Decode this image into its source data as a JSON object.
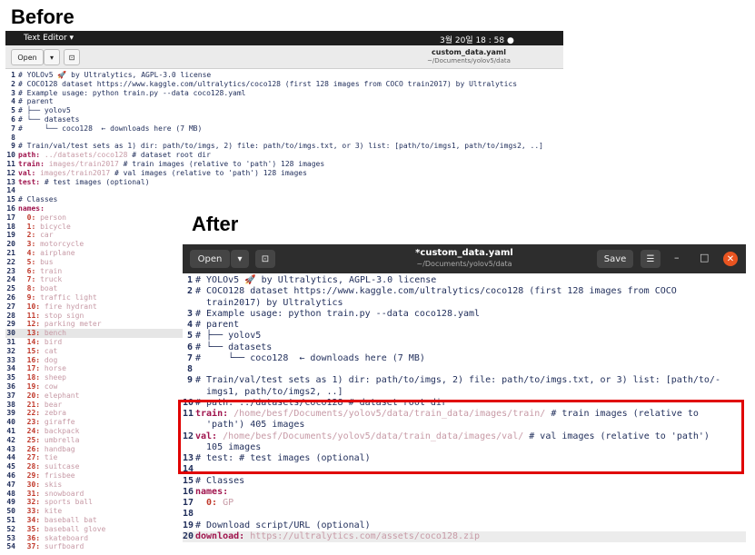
{
  "labels": {
    "before": "Before",
    "after": "After"
  },
  "colors": {
    "accent_red": "#e00000",
    "close_orange": "#e95420",
    "key": "#a0154e",
    "value": "#c79aa6"
  },
  "top_bar": {
    "app": "Text Editor ▾",
    "clock": "3월 20일  18 : 58  ●"
  },
  "before": {
    "open_label": "Open",
    "title": "custom_data.yaml",
    "subtitle": "~/Documents/yolov5/data",
    "lines": [
      {
        "n": "1",
        "t": "# YOLOv5 🚀 by Ultralytics, AGPL-3.0 license"
      },
      {
        "n": "2",
        "t": "# COCO128 dataset https://www.kaggle.com/ultralytics/coco128 (first 128 images from COCO train2017) by Ultralytics"
      },
      {
        "n": "3",
        "t": "# Example usage: python train.py --data coco128.yaml"
      },
      {
        "n": "4",
        "t": "# parent"
      },
      {
        "n": "5",
        "t": "# ├── yolov5"
      },
      {
        "n": "6",
        "t": "# └── datasets"
      },
      {
        "n": "7",
        "t": "#     └── coco128  ← downloads here (7 MB)"
      },
      {
        "n": "8",
        "t": ""
      },
      {
        "n": "9",
        "t": "# Train/val/test sets as 1) dir: path/to/imgs, 2) file: path/to/imgs.txt, or 3) list: [path/to/imgs1, path/to/imgs2, ..]"
      },
      {
        "n": "10",
        "k": "path:",
        "v": " ../datasets/coco128",
        "c": " # dataset root dir"
      },
      {
        "n": "11",
        "k": "train:",
        "v": " images/train2017",
        "c": " # train images (relative to 'path') 128 images"
      },
      {
        "n": "12",
        "k": "val:",
        "v": " images/train2017",
        "c": " # val images (relative to 'path') 128 images"
      },
      {
        "n": "13",
        "k": "test:",
        "v": "",
        "c": " # test images (optional)"
      },
      {
        "n": "14",
        "t": ""
      },
      {
        "n": "15",
        "t": "# Classes"
      },
      {
        "n": "16",
        "k": "names:",
        "v": "",
        "c": ""
      }
    ],
    "classes": [
      [
        "17",
        "0",
        "person"
      ],
      [
        "18",
        "1",
        "bicycle"
      ],
      [
        "19",
        "2",
        "car"
      ],
      [
        "20",
        "3",
        "motorcycle"
      ],
      [
        "21",
        "4",
        "airplane"
      ],
      [
        "22",
        "5",
        "bus"
      ],
      [
        "23",
        "6",
        "train"
      ],
      [
        "24",
        "7",
        "truck"
      ],
      [
        "25",
        "8",
        "boat"
      ],
      [
        "26",
        "9",
        "traffic light"
      ],
      [
        "27",
        "10",
        "fire hydrant"
      ],
      [
        "28",
        "11",
        "stop sign"
      ],
      [
        "29",
        "12",
        "parking meter"
      ],
      [
        "30",
        "13",
        "bench"
      ],
      [
        "31",
        "14",
        "bird"
      ],
      [
        "32",
        "15",
        "cat"
      ],
      [
        "33",
        "16",
        "dog"
      ],
      [
        "34",
        "17",
        "horse"
      ],
      [
        "35",
        "18",
        "sheep"
      ],
      [
        "36",
        "19",
        "cow"
      ],
      [
        "37",
        "20",
        "elephant"
      ],
      [
        "38",
        "21",
        "bear"
      ],
      [
        "39",
        "22",
        "zebra"
      ],
      [
        "40",
        "23",
        "giraffe"
      ],
      [
        "41",
        "24",
        "backpack"
      ],
      [
        "42",
        "25",
        "umbrella"
      ],
      [
        "43",
        "26",
        "handbag"
      ],
      [
        "44",
        "27",
        "tie"
      ],
      [
        "45",
        "28",
        "suitcase"
      ],
      [
        "46",
        "29",
        "frisbee"
      ],
      [
        "47",
        "30",
        "skis"
      ],
      [
        "48",
        "31",
        "snowboard"
      ],
      [
        "49",
        "32",
        "sports ball"
      ],
      [
        "50",
        "33",
        "kite"
      ],
      [
        "51",
        "34",
        "baseball bat"
      ],
      [
        "52",
        "35",
        "baseball glove"
      ],
      [
        "53",
        "36",
        "skateboard"
      ],
      [
        "54",
        "37",
        "surfboard"
      ]
    ]
  },
  "after": {
    "open_label": "Open",
    "save_label": "Save",
    "title": "*custom_data.yaml",
    "subtitle": "~/Documents/yolov5/data",
    "lines": [
      {
        "n": "1",
        "segs": [
          [
            "# YOLOv5 🚀 by Ultralytics, AGPL-3.0 license",
            ""
          ]
        ]
      },
      {
        "n": "2",
        "segs": [
          [
            "# COCO128 dataset https://www.kaggle.com/ultralytics/coco128 (first 128 images from COCO",
            ""
          ]
        ]
      },
      {
        "n": "",
        "segs": [
          [
            "  train2017) by Ultralytics",
            ""
          ]
        ]
      },
      {
        "n": "3",
        "segs": [
          [
            "# Example usage: python train.py --data coco128.yaml",
            ""
          ]
        ]
      },
      {
        "n": "4",
        "segs": [
          [
            "# parent",
            ""
          ]
        ]
      },
      {
        "n": "5",
        "segs": [
          [
            "# ├── yolov5",
            ""
          ]
        ]
      },
      {
        "n": "6",
        "segs": [
          [
            "# └── datasets",
            ""
          ]
        ]
      },
      {
        "n": "7",
        "segs": [
          [
            "#     └── coco128  ← downloads here (7 MB)",
            ""
          ]
        ]
      },
      {
        "n": "8",
        "segs": [
          [
            "",
            ""
          ]
        ]
      },
      {
        "n": "9",
        "segs": [
          [
            "# Train/val/test sets as 1) dir: path/to/imgs, 2) file: path/to/imgs.txt, or 3) list: [path/to/-",
            ""
          ]
        ]
      },
      {
        "n": "",
        "segs": [
          [
            "  imgs1, path/to/imgs2, ..]",
            ""
          ]
        ]
      },
      {
        "n": "10",
        "segs": [
          [
            "# path: ../datasets/coco128 # dataset root dir",
            ""
          ]
        ]
      },
      {
        "n": "11",
        "segs": [
          [
            "train:",
            "key"
          ],
          [
            " /home/besf/Documents/yolov5/data/train_data/images/train/",
            "val"
          ],
          [
            " # train images (relative to",
            ""
          ]
        ]
      },
      {
        "n": "",
        "segs": [
          [
            "  'path') 405 images",
            ""
          ]
        ]
      },
      {
        "n": "12",
        "segs": [
          [
            "val:",
            "key"
          ],
          [
            " /home/besf/Documents/yolov5/data/train_data/images/val/",
            "val"
          ],
          [
            " # val images (relative to 'path')",
            ""
          ]
        ]
      },
      {
        "n": "",
        "segs": [
          [
            "  105 images",
            ""
          ]
        ]
      },
      {
        "n": "13",
        "segs": [
          [
            "# test: # test images (optional)",
            ""
          ]
        ]
      },
      {
        "n": "14",
        "segs": [
          [
            "",
            ""
          ]
        ]
      },
      {
        "n": "15",
        "segs": [
          [
            "# Classes",
            ""
          ]
        ]
      },
      {
        "n": "16",
        "segs": [
          [
            "names:",
            "key"
          ]
        ]
      },
      {
        "n": "17",
        "segs": [
          [
            "  0:",
            "cls"
          ],
          [
            " GP",
            "val"
          ]
        ]
      },
      {
        "n": "18",
        "segs": [
          [
            "",
            ""
          ]
        ]
      },
      {
        "n": "19",
        "segs": [
          [
            "# Download script/URL (optional)",
            ""
          ]
        ]
      },
      {
        "n": "20",
        "segs": [
          [
            "download:",
            "key"
          ],
          [
            " https://ultralytics.com/assets/coco128.zip",
            "val"
          ]
        ]
      }
    ]
  }
}
